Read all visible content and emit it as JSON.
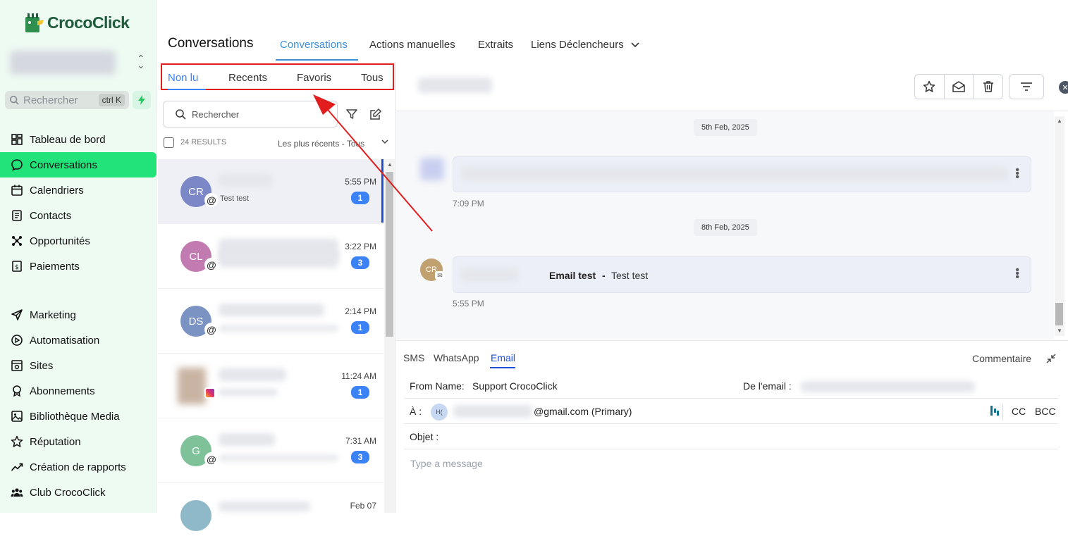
{
  "app": {
    "brand": "CrocoClick"
  },
  "sidebar": {
    "search_placeholder": "Rechercher",
    "search_shortcut": "ctrl K",
    "items": [
      {
        "label": "Tableau de bord",
        "icon": "dashboard-icon"
      },
      {
        "label": "Conversations",
        "icon": "chat-icon",
        "active": true
      },
      {
        "label": "Calendriers",
        "icon": "calendar-icon"
      },
      {
        "label": "Contacts",
        "icon": "contacts-icon"
      },
      {
        "label": "Opportunités",
        "icon": "opportunities-icon"
      },
      {
        "label": "Paiements",
        "icon": "payments-icon"
      },
      {
        "label": "Marketing",
        "icon": "send-icon"
      },
      {
        "label": "Automatisation",
        "icon": "automation-icon"
      },
      {
        "label": "Sites",
        "icon": "sites-icon"
      },
      {
        "label": "Abonnements",
        "icon": "memberships-icon"
      },
      {
        "label": "Bibliothèque Media",
        "icon": "media-icon"
      },
      {
        "label": "Réputation",
        "icon": "star-icon"
      },
      {
        "label": "Création de rapports",
        "icon": "reporting-icon"
      },
      {
        "label": "Club CrocoClick",
        "icon": "community-icon"
      }
    ]
  },
  "header": {
    "title": "Conversations",
    "tabs": [
      "Conversations",
      "Actions manuelles",
      "Extraits",
      "Liens Déclencheurs"
    ]
  },
  "list": {
    "filter_tabs": [
      "Non lu",
      "Recents",
      "Favoris",
      "Tous"
    ],
    "search_placeholder": "Rechercher",
    "results": "24 RESULTS",
    "sort": "Les plus récents - Tous",
    "conversations": [
      {
        "initials": "CR",
        "color": "#7b87c6",
        "preview": "Test test",
        "time": "5:55 PM",
        "count": "1",
        "channel": "@"
      },
      {
        "initials": "CL",
        "color": "#c27bb0",
        "preview": "",
        "time": "3:22 PM",
        "count": "3",
        "channel": "@"
      },
      {
        "initials": "DS",
        "color": "#7a93c2",
        "preview": "",
        "time": "2:14 PM",
        "count": "1",
        "channel": "@"
      },
      {
        "initials": "",
        "color": "#c9b3a3",
        "preview": "",
        "time": "11:24 AM",
        "count": "1",
        "channel": "instagram"
      },
      {
        "initials": "G",
        "color": "#7fc29a",
        "preview": "",
        "time": "7:31 AM",
        "count": "3",
        "channel": "@"
      },
      {
        "initials": "",
        "color": "#8fb8c8",
        "preview": "",
        "time": "Feb 07",
        "count": "",
        "channel": ""
      }
    ]
  },
  "messages": {
    "dates": [
      "5th Feb, 2025",
      "8th Feb, 2025"
    ],
    "msg1_time": "7:09 PM",
    "msg2": {
      "avatar": "CR",
      "subject": "Email test",
      "separator": "-",
      "body": "Test test",
      "time": "5:55 PM"
    }
  },
  "composer": {
    "tabs": [
      "SMS",
      "WhatsApp",
      "Email"
    ],
    "active_tab": "Email",
    "comment": "Commentaire",
    "from_label": "From Name:",
    "from_value": "Support CrocoClick",
    "from_email_label": "De l'email :",
    "to_label": "À :",
    "to_avatar": "H(",
    "to_value": "@gmail.com (Primary)",
    "cc": "CC",
    "bcc": "BCC",
    "subject_label": "Objet :",
    "placeholder": "Type a message"
  },
  "colors": {
    "accent": "#3b82f6",
    "sidebar_active": "#22e37a",
    "annotation": "#e11d1d"
  }
}
